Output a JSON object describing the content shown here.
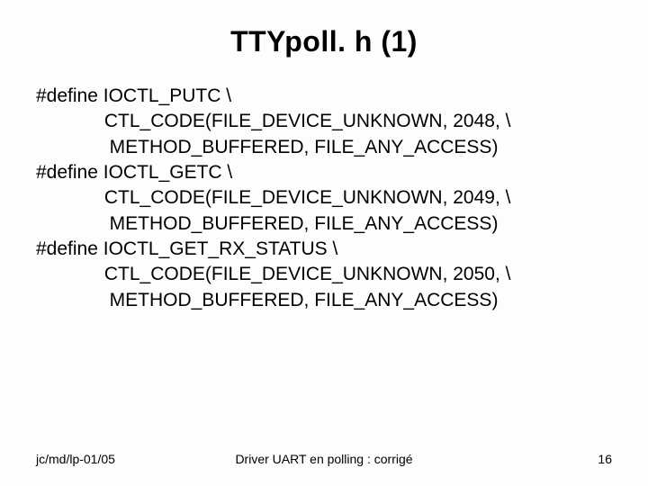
{
  "title": "TTYpoll. h (1)",
  "code": {
    "l0": "#define IOCTL_PUTC \\",
    "l1": "             CTL_CODE(FILE_DEVICE_UNKNOWN, 2048, \\",
    "l2": "              METHOD_BUFFERED, FILE_ANY_ACCESS)",
    "l3": "#define IOCTL_GETC \\",
    "l4": "             CTL_CODE(FILE_DEVICE_UNKNOWN, 2049, \\",
    "l5": "              METHOD_BUFFERED, FILE_ANY_ACCESS)",
    "l6": "#define IOCTL_GET_RX_STATUS \\",
    "l7": "             CTL_CODE(FILE_DEVICE_UNKNOWN, 2050, \\",
    "l8": "              METHOD_BUFFERED, FILE_ANY_ACCESS)"
  },
  "footer": {
    "left": "jc/md/lp-01/05",
    "center": "Driver UART en polling : corrigé",
    "page": "16"
  }
}
